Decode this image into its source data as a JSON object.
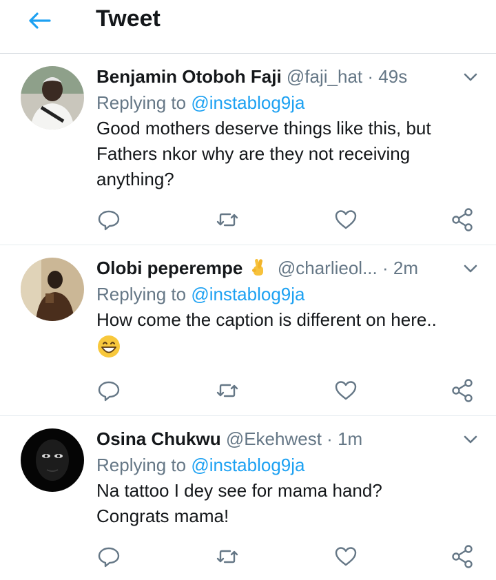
{
  "header": {
    "title": "Tweet"
  },
  "tweets": [
    {
      "name": "Benjamin Otoboh Faji",
      "handle": "@faji_hat",
      "dot": "·",
      "time": "49s",
      "replying_label": "Replying to",
      "mention": "@instablog9ja",
      "text": "Good mothers deserve things like this, but\nFathers nkor why are they not receiving\nanything?"
    },
    {
      "name": "Olobi peperempe",
      "handle": "@charlieol...",
      "dot": "·",
      "time": "2m",
      "replying_label": "Replying to",
      "mention": "@instablog9ja",
      "text": "How come the caption is different on here.."
    },
    {
      "name": "Osina Chukwu",
      "handle": "@Ekehwest",
      "dot": "·",
      "time": "1m",
      "replying_label": "Replying to",
      "mention": "@instablog9ja",
      "text": "Na tattoo I dey see for mama hand?\nCongrats mama!"
    }
  ],
  "icons": {
    "back": "arrow-left",
    "reply": "speech-bubble",
    "retweet": "retweet-arrows",
    "like": "heart",
    "share": "share-nodes",
    "caret": "chevron-down",
    "name_emoji": "crossed-fingers",
    "text_emoji": "grinning-face"
  },
  "colors": {
    "accent": "#1da1f2",
    "secondary": "#657786",
    "icon": "#657786",
    "text": "#14171a"
  }
}
